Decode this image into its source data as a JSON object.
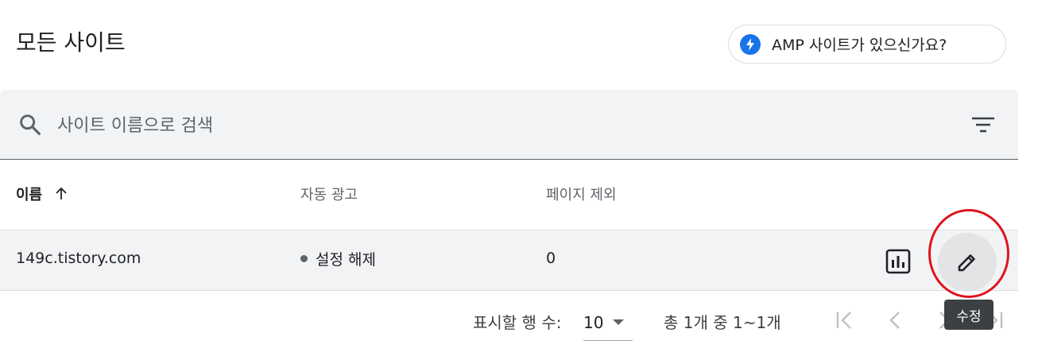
{
  "header": {
    "title": "모든 사이트",
    "amp_chip_label": "AMP 사이트가 있으신가요?"
  },
  "search": {
    "placeholder": "사이트 이름으로 검색",
    "value": ""
  },
  "table": {
    "columns": [
      "이름",
      "자동 광고",
      "페이지 제외"
    ],
    "rows": [
      {
        "site": "149c.tistory.com",
        "auto_ads": "설정 해제",
        "excluded_pages": "0"
      }
    ]
  },
  "tooltip": {
    "edit": "수정"
  },
  "pagination": {
    "rows_per_page_label": "표시할 행 수:",
    "rows_per_page_value": "10",
    "range_label": "총 1개 중 1~1개"
  },
  "colors": {
    "accent": "#1a73e8",
    "highlight": "#e0131c",
    "row_bg": "#f1f3f4"
  },
  "icons": [
    "amp-bolt-icon",
    "search-icon",
    "filter-icon",
    "sort-arrow-up-icon",
    "bar-chart-icon",
    "pencil-icon",
    "first-page-icon",
    "prev-page-icon",
    "next-page-icon",
    "last-page-icon"
  ]
}
